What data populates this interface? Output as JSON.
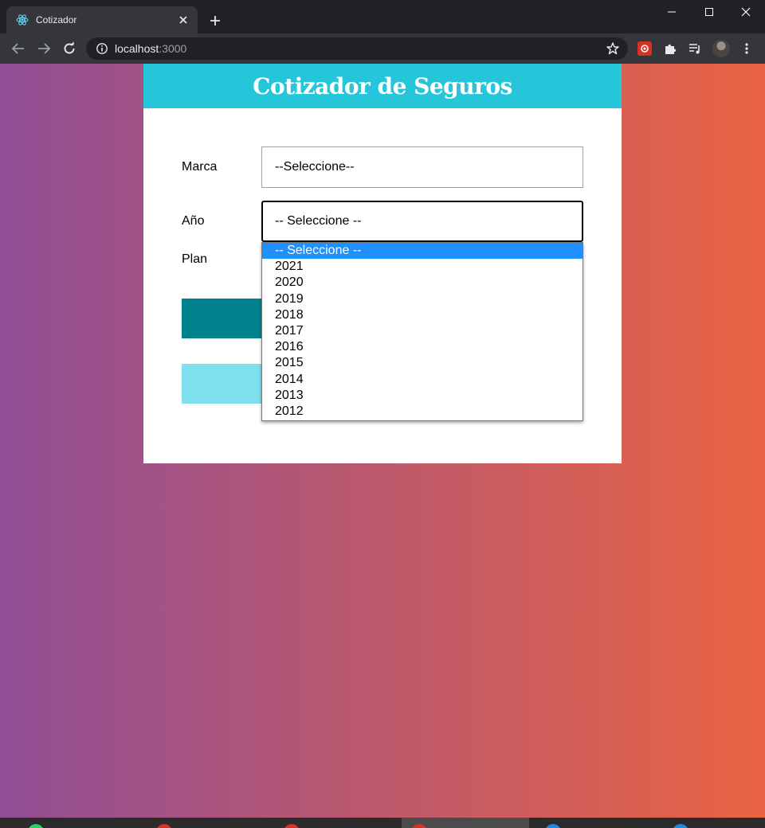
{
  "browser": {
    "tab_title": "Cotizador",
    "url_host": "localhost",
    "url_port": ":3000"
  },
  "page": {
    "header_title": "Cotizador de Seguros",
    "form": {
      "marca_label": "Marca",
      "marca_value": "--Seleccione--",
      "anio_label": "Año",
      "anio_value": "-- Seleccione --",
      "plan_label": "Plan"
    },
    "anio_options": [
      "-- Seleccione --",
      "2021",
      "2020",
      "2019",
      "2018",
      "2017",
      "2016",
      "2015",
      "2014",
      "2013",
      "2012"
    ],
    "anio_selected_option": "-- Seleccione --"
  },
  "colors": {
    "header_bg": "#26c6da",
    "primary_button": "#00838f",
    "secondary_button": "#7fe0ed",
    "gradient_start": "#904e95",
    "gradient_end": "#e96443",
    "option_highlight": "#1e90ff"
  },
  "icons": {
    "tab_favicon": "react-icon",
    "tab_close": "close-icon",
    "new_tab": "plus-icon",
    "back": "back-arrow-icon",
    "forward": "forward-arrow-icon",
    "reload": "reload-icon",
    "site_info": "info-icon",
    "bookmark": "star-icon",
    "extensions": "puzzle-icon",
    "media": "playlist-icon",
    "menu": "kebab-menu-icon"
  }
}
